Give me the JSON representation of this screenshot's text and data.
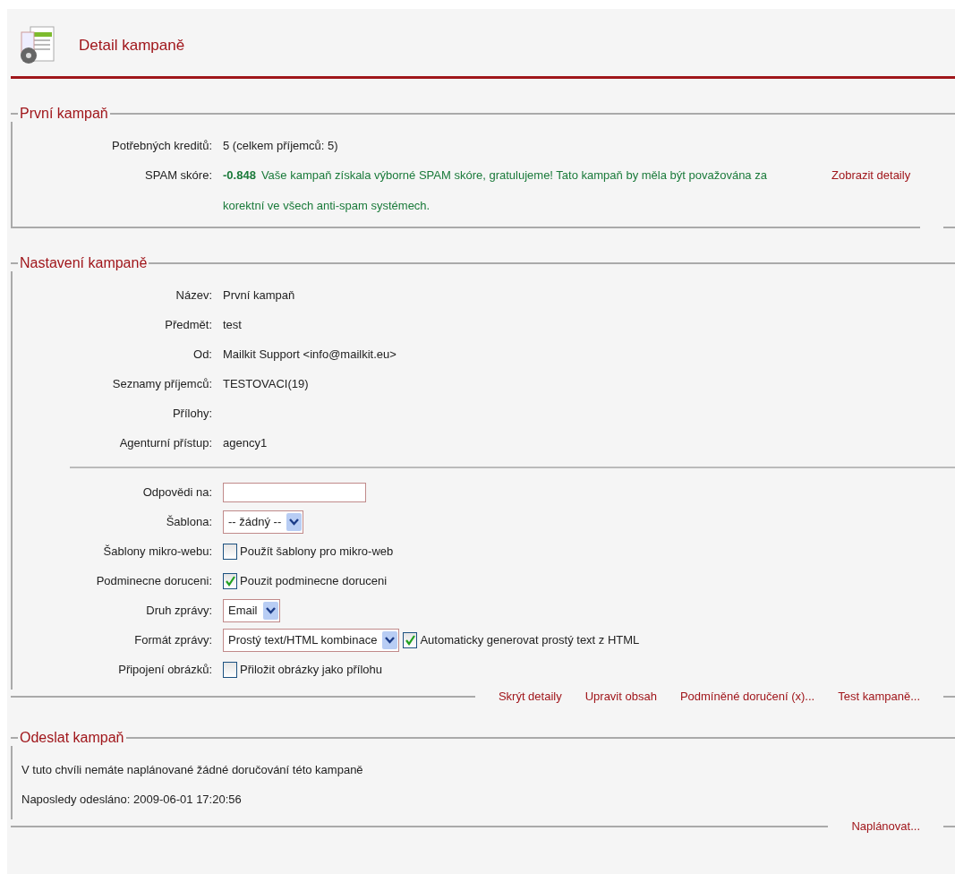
{
  "header": {
    "title": "Detail kampaně"
  },
  "sections": [
    {
      "legend": "První kampaň",
      "rows": [
        {
          "kind": "text",
          "label": "Potřebných kreditů:",
          "value": "5 (celkem příjemců: 5)"
        },
        {
          "kind": "spam",
          "label": "SPAM skóre:",
          "score": "-0.848",
          "message": "Vaše kampaň získala výborné SPAM skóre, gratulujeme! Tato kampaň by měla být považována za korektní ve všech anti-spam systémech.",
          "link": "Zobrazit detaily"
        }
      ]
    },
    {
      "legend": "Nastavení kampaně",
      "rows": [
        {
          "kind": "text",
          "label": "Název:",
          "value": "První kampaň"
        },
        {
          "kind": "text",
          "label": "Předmět:",
          "value": "test"
        },
        {
          "kind": "text",
          "label": "Od:",
          "value": "Mailkit Support <info@mailkit.eu>"
        },
        {
          "kind": "text",
          "label": "Seznamy příjemců:",
          "value": "TESTOVACI(19)"
        },
        {
          "kind": "text",
          "label": "Přílohy:"
        },
        {
          "kind": "text",
          "label": "Agenturní přístup:",
          "value": "agency1"
        },
        {
          "kind": "divider"
        },
        {
          "kind": "input",
          "label": "Odpovědi na:"
        },
        {
          "kind": "select",
          "label": "Šablona:",
          "value": "-- žádný --"
        },
        {
          "kind": "checkbox",
          "label": "Šablony mikro-webu:",
          "option": "Použít šablony pro mikro-web",
          "checked": false
        },
        {
          "kind": "checkbox",
          "label": "Podminecne doruceni:",
          "option": "Pouzit podminecne doruceni",
          "checked": true
        },
        {
          "kind": "select",
          "label": "Druh zprávy:",
          "value": "Email"
        },
        {
          "kind": "select_checkbox",
          "label": "Formát zprávy:",
          "value": "Prostý text/HTML kombinace",
          "option": "Automaticky generovat prostý text z HTML",
          "checked": true
        },
        {
          "kind": "checkbox",
          "label": "Připojení obrázků:",
          "option": "Přiložit obrázky jako přílohu",
          "checked": false
        }
      ],
      "links": [
        "Skrýt detaily",
        "Upravit obsah",
        "Podmíněné doručení (x)...",
        "Test kampaně..."
      ]
    },
    {
      "legend": "Odeslat kampaň",
      "paragraphs": [
        "V tuto chvíli nemáte naplánované žádné doručování této kampaně",
        "Naposledy odesláno: 2009-06-01 17:20:56"
      ],
      "links": [
        "Naplánovat..."
      ]
    }
  ]
}
